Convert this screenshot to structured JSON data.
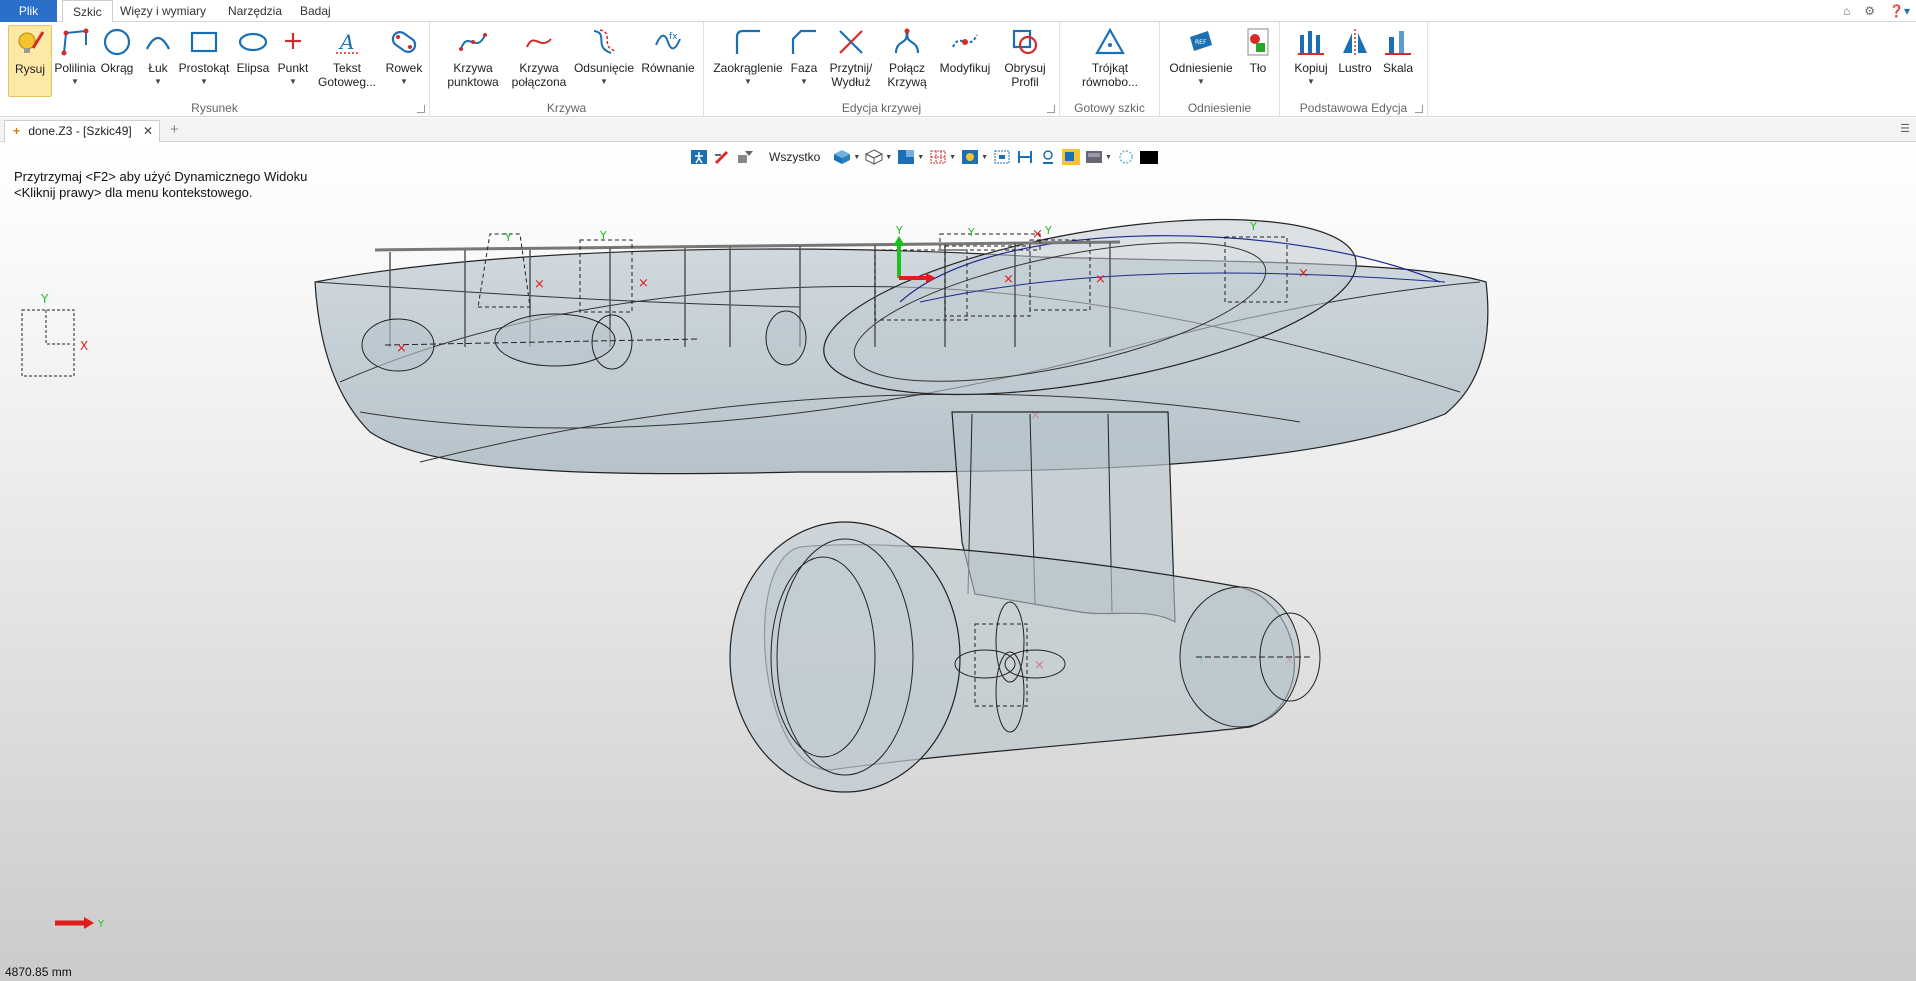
{
  "menu": {
    "tabs": [
      {
        "label": "Plik"
      },
      {
        "label": "Szkic"
      },
      {
        "label": "Więzy i wymiary"
      },
      {
        "label": "Narzędzia"
      },
      {
        "label": "Badaj"
      }
    ],
    "right_icons": [
      "up-icon",
      "settings-icon",
      "help-icon"
    ]
  },
  "ribbon": {
    "groups": [
      {
        "label": "Rysunek",
        "buttons": [
          {
            "label": "Rysuj",
            "icon": "pencil-lightbulb-icon",
            "active": true
          },
          {
            "label": "Polilinia",
            "icon": "polyline-icon"
          },
          {
            "label": "Okrąg",
            "icon": "circle-icon"
          },
          {
            "label": "Łuk",
            "icon": "arc-icon"
          },
          {
            "label": "Prostokąt",
            "icon": "rectangle-icon"
          },
          {
            "label": "Elipsa",
            "icon": "ellipse-icon"
          },
          {
            "label": "Punkt",
            "icon": "point-icon"
          },
          {
            "label": "Tekst Gotoweg...",
            "icon": "text-icon"
          },
          {
            "label": "Rowek",
            "icon": "slot-icon"
          }
        ]
      },
      {
        "label": "Krzywa",
        "buttons": [
          {
            "label": "Krzywa punktowa",
            "icon": "spline-icon"
          },
          {
            "label": "Krzywa połączona",
            "icon": "connected-curve-icon"
          },
          {
            "label": "Odsunięcie",
            "icon": "offset-icon"
          },
          {
            "label": "Równanie",
            "icon": "equation-icon"
          }
        ]
      },
      {
        "label": "Edycja krzywej",
        "buttons": [
          {
            "label": "Zaokrąglenie",
            "icon": "fillet-icon"
          },
          {
            "label": "Faza",
            "icon": "chamfer-icon"
          },
          {
            "label": "Przytnij/ Wydłuż",
            "icon": "trim-icon"
          },
          {
            "label": "Połącz Krzywą",
            "icon": "join-curve-icon"
          },
          {
            "label": "Modyfikuj",
            "icon": "modify-icon"
          },
          {
            "label": "Obrysuj Profil",
            "icon": "trace-profile-icon"
          }
        ]
      },
      {
        "label": "Gotowy szkic",
        "buttons": [
          {
            "label": "Trójkąt równobo...",
            "icon": "triangle-icon"
          }
        ]
      },
      {
        "label": "Odniesienie",
        "buttons": [
          {
            "label": "Odniesienie",
            "icon": "reference-icon"
          },
          {
            "label": "Tło",
            "icon": "background-icon"
          }
        ]
      },
      {
        "label": "Podstawowa Edycja",
        "buttons": [
          {
            "label": "Kopiuj",
            "icon": "copy-icon"
          },
          {
            "label": "Lustro",
            "icon": "mirror-icon"
          },
          {
            "label": "Skala",
            "icon": "scale-icon"
          }
        ]
      }
    ]
  },
  "document": {
    "tab_label": "done.Z3 - [Szkic49]"
  },
  "viewport": {
    "hint_line1": "Przytrzymaj <F2> aby użyć Dynamicznego Widoku",
    "hint_line2": "<Kliknij prawy> dla menu kontekstowego.",
    "filter_label": "Wszystko",
    "axis_labels": {
      "y": "Y",
      "x": "X"
    },
    "status_value": "4870.85 mm"
  },
  "colors": {
    "accent": "#2a6fc9",
    "icon_blue": "#1a6fb5",
    "icon_red": "#d42b2b",
    "axis_green": "#1fbf1f",
    "axis_red": "#e01d1d",
    "model_fill": "#a9bac4"
  }
}
